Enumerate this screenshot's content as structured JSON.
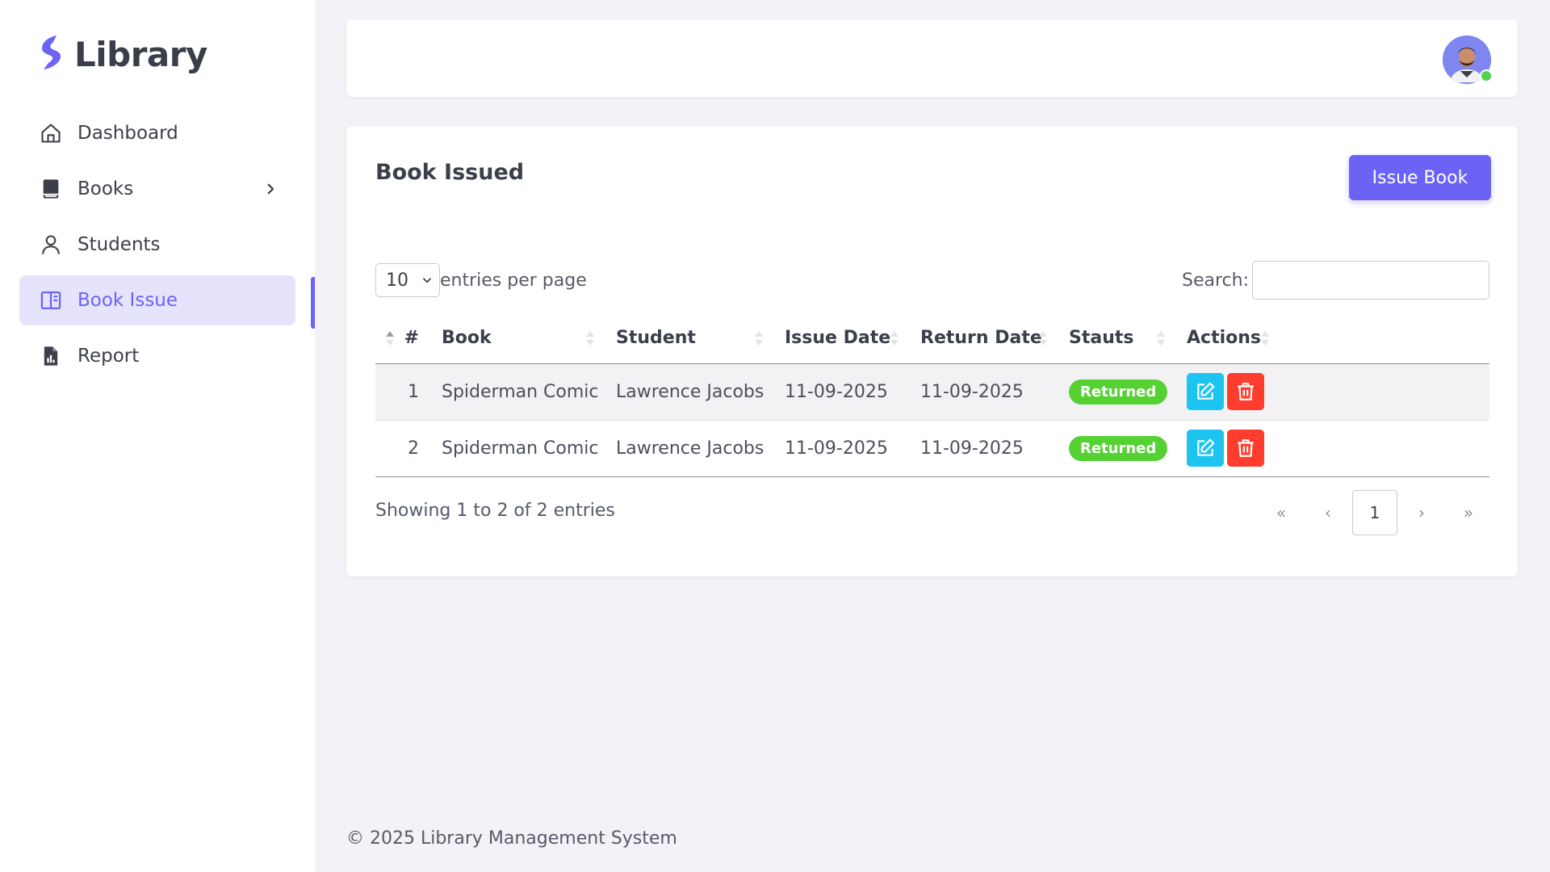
{
  "brand": {
    "name": "Library",
    "logo_icon": "bolt-logo-icon",
    "accent": "#6c63f5"
  },
  "sidebar": {
    "items": [
      {
        "label": "Dashboard",
        "icon": "home-icon",
        "active": false
      },
      {
        "label": "Books",
        "icon": "book-icon",
        "active": false,
        "has_submenu": true
      },
      {
        "label": "Students",
        "icon": "user-icon",
        "active": false
      },
      {
        "label": "Book Issue",
        "icon": "book-open-icon",
        "active": true
      },
      {
        "label": "Report",
        "icon": "report-file-icon",
        "active": false
      }
    ]
  },
  "header": {
    "avatar_status": "online",
    "status_color": "#4fd34f"
  },
  "card": {
    "title": "Book Issued",
    "issue_button": "Issue Book",
    "length": {
      "value": "10",
      "suffix": "entries per page"
    },
    "search": {
      "label": "Search:",
      "placeholder": "",
      "value": ""
    },
    "columns": [
      "#",
      "Book",
      "Student",
      "Issue Date",
      "Return Date",
      "Stauts",
      "Actions"
    ],
    "rows": [
      {
        "num": "1",
        "book": "Spiderman Comic",
        "student": "Lawrence Jacobs",
        "issue_date": "11-09-2025",
        "return_date": "11-09-2025",
        "status": "Returned"
      },
      {
        "num": "2",
        "book": "Spiderman Comic",
        "student": "Lawrence Jacobs",
        "issue_date": "11-09-2025",
        "return_date": "11-09-2025",
        "status": "Returned"
      }
    ],
    "info": "Showing 1 to 2 of 2 entries",
    "pagination": {
      "first": "«",
      "prev": "‹",
      "current": "1",
      "next": "›",
      "last": "»"
    },
    "colors": {
      "returned": "#56d134",
      "edit": "#1cc4ef",
      "delete": "#ff3d2e"
    }
  },
  "footer": {
    "text": "© 2025 Library Management System"
  }
}
